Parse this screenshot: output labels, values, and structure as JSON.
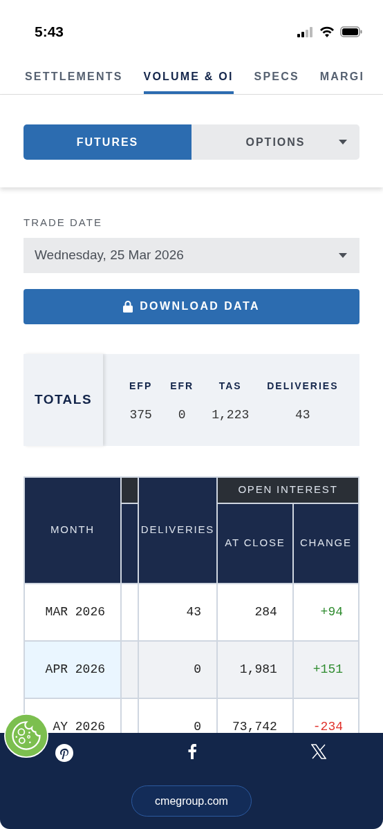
{
  "status_bar": {
    "time": "5:43"
  },
  "tabs": [
    {
      "label": "SETTLEMENTS",
      "selected": false
    },
    {
      "label": "VOLUME & OI",
      "selected": true
    },
    {
      "label": "SPECS",
      "selected": false
    },
    {
      "label": "MARGI",
      "selected": false
    }
  ],
  "segments": [
    {
      "label": "FUTURES",
      "selected": true,
      "dropdown": false
    },
    {
      "label": "OPTIONS",
      "selected": false,
      "dropdown": true
    }
  ],
  "trade_date": {
    "label": "TRADE DATE",
    "value": "Wednesday, 25 Mar 2026"
  },
  "download_button": {
    "label": "DOWNLOAD DATA",
    "locked": true
  },
  "totals": {
    "title": "TOTALS",
    "columns": [
      {
        "heading": "EFP",
        "value": "375"
      },
      {
        "heading": "EFR",
        "value": "0"
      },
      {
        "heading": "TAS",
        "value": "1,223"
      },
      {
        "heading": "DELIVERIES",
        "value": "43"
      }
    ]
  },
  "table": {
    "group_heading": "OPEN INTEREST",
    "columns": [
      "MONTH",
      "DELIVERIES",
      "AT CLOSE",
      "CHANGE"
    ],
    "rows": [
      {
        "month": "MAR 2026",
        "deliveries": "43",
        "at_close": "284",
        "change": "+94",
        "color": "#2e8b2e",
        "selected": false
      },
      {
        "month": "APR 2026",
        "deliveries": "0",
        "at_close": "1,981",
        "change": "+151",
        "color": "#2e8b2e",
        "selected": true
      },
      {
        "month": "AY 2026",
        "deliveries": "0",
        "at_close": "73,742",
        "change": "-234",
        "color": "#e0302a",
        "selected": false
      }
    ]
  },
  "footer": {
    "link": "cmegroup.com"
  }
}
